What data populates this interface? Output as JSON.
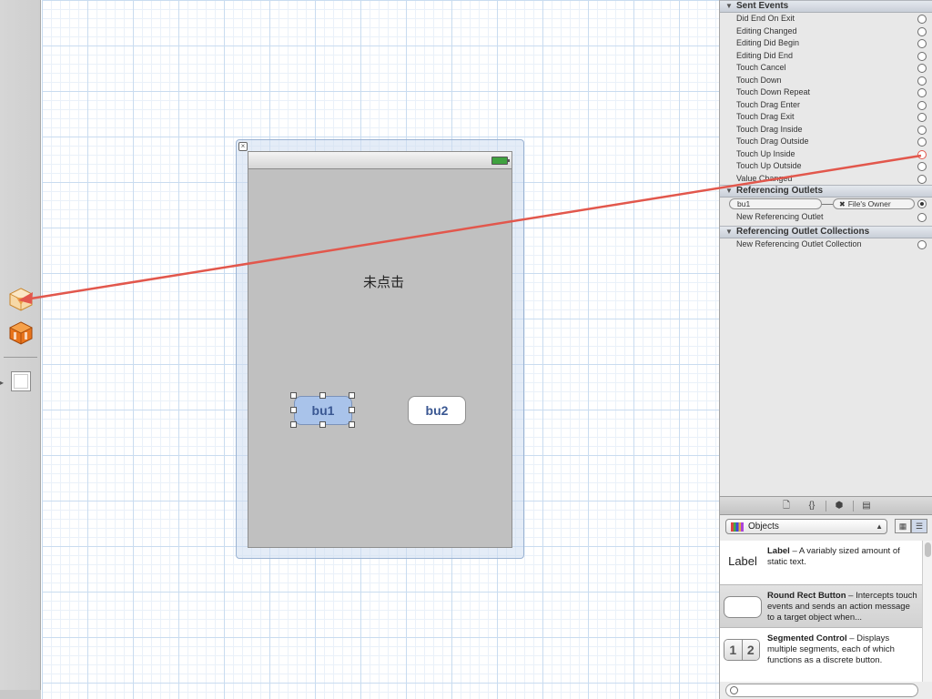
{
  "canvas": {
    "view_label": "未点击",
    "buttons": [
      {
        "title": "bu1",
        "selected": true
      },
      {
        "title": "bu2",
        "selected": false
      }
    ]
  },
  "inspector": {
    "sent_events": {
      "title": "Sent Events",
      "items": [
        {
          "label": "Did End On Exit",
          "connected": false
        },
        {
          "label": "Editing Changed",
          "connected": false
        },
        {
          "label": "Editing Did Begin",
          "connected": false
        },
        {
          "label": "Editing Did End",
          "connected": false
        },
        {
          "label": "Touch Cancel",
          "connected": false
        },
        {
          "label": "Touch Down",
          "connected": false
        },
        {
          "label": "Touch Down Repeat",
          "connected": false
        },
        {
          "label": "Touch Drag Enter",
          "connected": false
        },
        {
          "label": "Touch Drag Exit",
          "connected": false
        },
        {
          "label": "Touch Drag Inside",
          "connected": false
        },
        {
          "label": "Touch Drag Outside",
          "connected": false
        },
        {
          "label": "Touch Up Inside",
          "connected": false,
          "dragging": true
        },
        {
          "label": "Touch Up Outside",
          "connected": false
        },
        {
          "label": "Value Changed",
          "connected": false
        }
      ]
    },
    "referencing_outlets": {
      "title": "Referencing Outlets",
      "outlet_name": "bu1",
      "outlet_target": "File's Owner",
      "new_label": "New Referencing Outlet"
    },
    "outlet_collections": {
      "title": "Referencing Outlet Collections",
      "new_label": "New Referencing Outlet Collection"
    }
  },
  "library": {
    "tab_icons": [
      "file-icon",
      "braces-icon",
      "cube-icon",
      "media-icon"
    ],
    "selected_category": "Objects",
    "items": [
      {
        "thumb": "Label",
        "name": "Label",
        "description": " – A variably sized amount of static text."
      },
      {
        "thumb": "",
        "name": "Round Rect Button",
        "description": " – Intercepts touch events and sends an action message to a target object when..."
      },
      {
        "thumb": "",
        "name": "Segmented Control",
        "description": " – Displays multiple segments, each of which functions as a discrete button."
      }
    ],
    "segment_thumb": [
      "1",
      "2"
    ]
  },
  "colors": {
    "connection_line": "#e2574c",
    "selected_button": "#a9c3ea",
    "button_text": "#3a5792",
    "view_background": "#c0c0c0"
  }
}
